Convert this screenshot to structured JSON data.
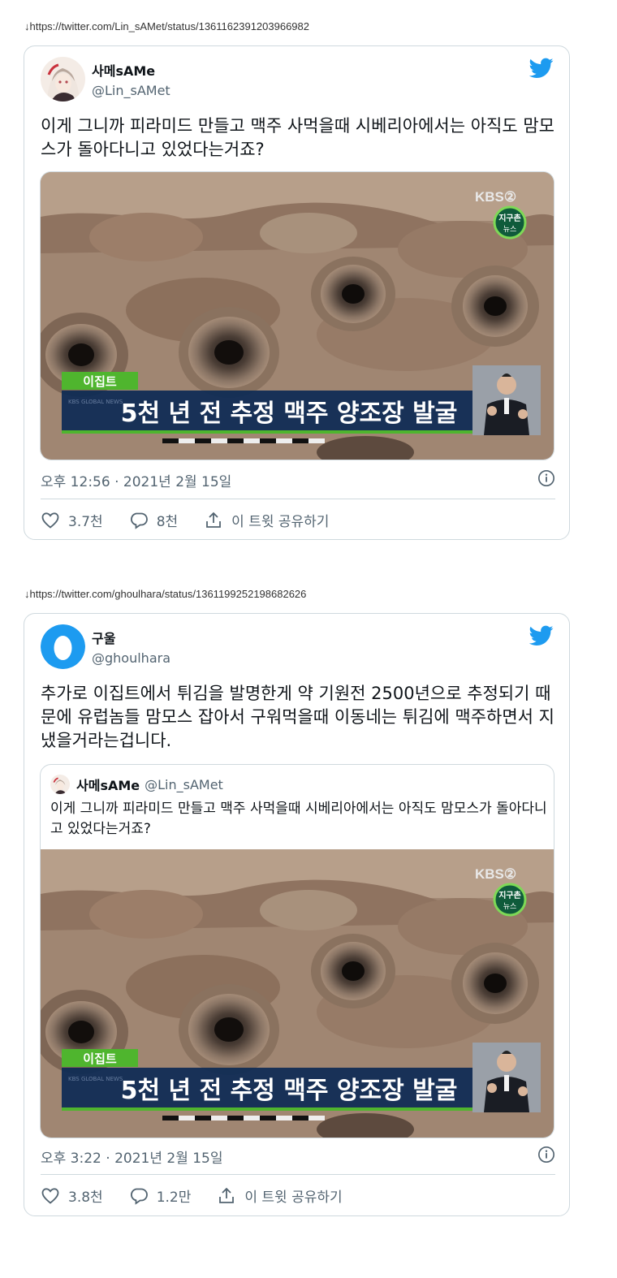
{
  "tweets": [
    {
      "source_url": "↓https://twitter.com/Lin_sAMet/status/1361162391203966982",
      "display_name": "사메sAMe",
      "handle": "@Lin_sAMet",
      "text": "이게 그니까 피라미드 만들고 맥주 사먹을때 시베리아에서는 아직도 맘모스가 돌아다니고 있었다는거죠?",
      "media": {
        "broadcaster": "KBS②",
        "program_badge": "지구촌 뉴스",
        "location_label": "이집트",
        "headline": "5천 년 전 추정 맥주 양조장 발굴",
        "watermark": "KBS GLOBAL NEWS"
      },
      "timestamp": "오후 12:56 · 2021년 2월 15일",
      "likes": "3.7천",
      "replies": "8천",
      "share_label": "이 트윗 공유하기"
    },
    {
      "source_url": "↓https://twitter.com/ghoulhara/status/1361199252198682626",
      "display_name": "구울",
      "handle": "@ghoulhara",
      "text": "추가로 이집트에서 튀김을 발명한게 약 기원전 2500년으로 추정되기 때문에 유럽놈들 맘모스 잡아서 구워먹을때 이동네는 튀김에 맥주하면서 지냈을거라는겁니다.",
      "quote": {
        "display_name": "사메sAMe",
        "handle": "@Lin_sAMet",
        "text": "이게 그니까 피라미드 만들고 맥주 사먹을때 시베리아에서는 아직도 맘모스가 돌아다니고 있었다는거죠?",
        "media": {
          "broadcaster": "KBS②",
          "program_badge": "지구촌 뉴스",
          "location_label": "이집트",
          "headline": "5천 년 전 추정 맥주 양조장 발굴",
          "watermark": "KBS GLOBAL NEWS"
        }
      },
      "timestamp": "오후 3:22 · 2021년 2월 15일",
      "likes": "3.8천",
      "replies": "1.2만",
      "share_label": "이 트윗 공유하기"
    }
  ],
  "colors": {
    "twitter_blue": "#1d9bf0",
    "text": "#0f1419",
    "muted": "#536471",
    "border": "#cfd9de",
    "kbs_green": "#4caf2a",
    "kbs_navy": "#0c2a55"
  }
}
